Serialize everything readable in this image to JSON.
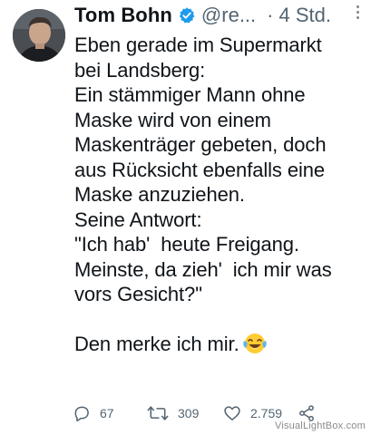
{
  "tweet": {
    "author_name": "Tom Bohn",
    "handle": "@re...",
    "separator": "·",
    "time": "4 Std.",
    "text": "Eben gerade im Supermarkt\nbei Landsberg:\nEin stämmiger Mann ohne\nMaske wird von einem\nMaskenträger gebeten, doch\naus Rücksicht ebenfalls eine\nMaske anzuziehen.\nSeine Antwort:\n\"Ich hab'  heute Freigang.\nMeinste, da zieh'  ich mir was\nvors Gesicht?\"\n\nDen merke ich mir.",
    "emoji": "face-with-tears-of-joy"
  },
  "actions": {
    "replies": "67",
    "retweets": "309",
    "likes": "2.759"
  },
  "icons": [
    "verified-badge-icon",
    "more-icon",
    "reply-icon",
    "retweet-icon",
    "like-icon",
    "share-icon"
  ],
  "colors": {
    "text": "#0f1419",
    "secondary": "#536471",
    "verified": "#1d9bf0",
    "background": "#ffffff"
  },
  "watermark": "VisualLightBox.com"
}
